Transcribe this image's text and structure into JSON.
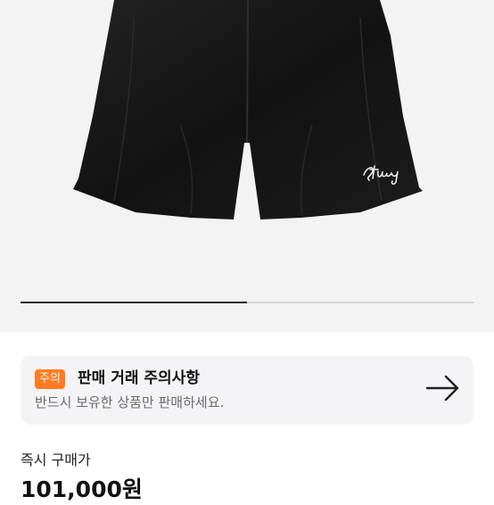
{
  "product": {
    "brand_logo_text": "Stüssy",
    "image_count": 2,
    "current_image": 1
  },
  "notice": {
    "badge": "주의",
    "title": "판매 거래 주의사항",
    "description": "반드시 보유한 상품만 판매하세요.",
    "badge_color": "#ff7a21",
    "arrow_icon": "arrow-right-icon"
  },
  "price": {
    "label": "즉시 구매가",
    "value": "101,000원"
  }
}
